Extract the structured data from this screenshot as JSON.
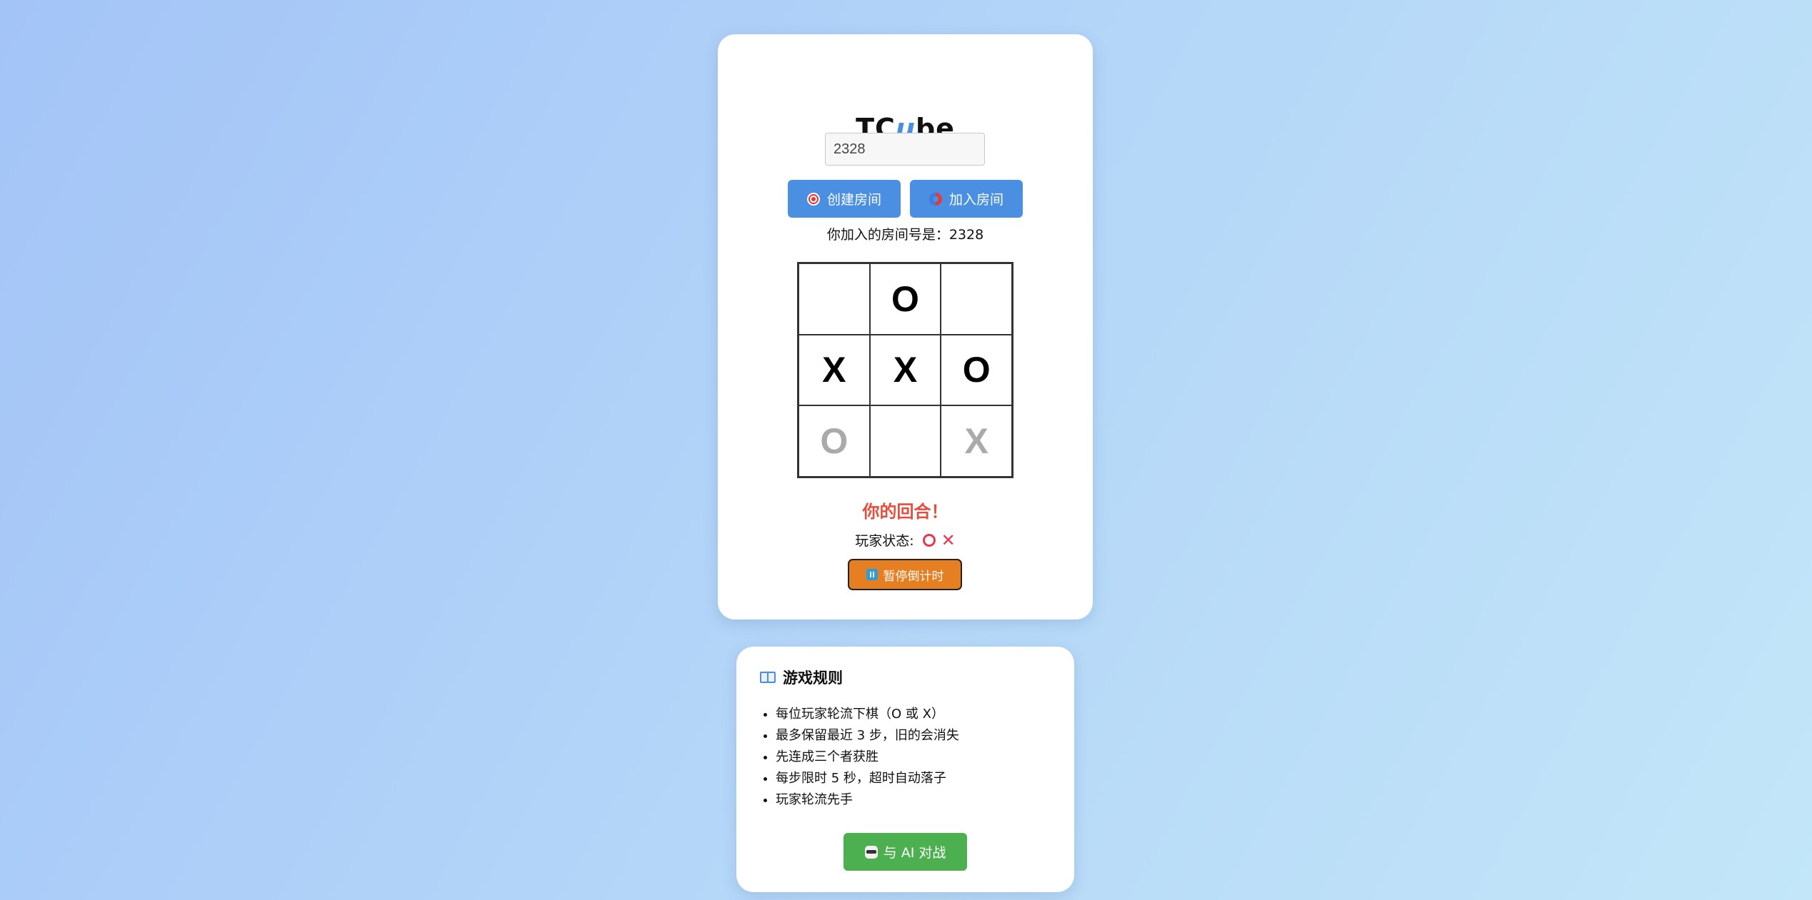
{
  "app": {
    "title_part1": "TC",
    "title_accent": "u",
    "title_part2": "be"
  },
  "room": {
    "input_value": "2328",
    "create_label": "创建房间",
    "create_icon": "target-icon",
    "join_label": "加入房间",
    "join_icon": "magnet-icon",
    "status_text": "你加入的房间号是：2328"
  },
  "board": {
    "cells": [
      "",
      "O",
      "",
      "X",
      "X",
      "O",
      "O",
      "",
      "X"
    ],
    "fading_cells": [
      6,
      8
    ]
  },
  "game": {
    "turn_text": "你的回合！",
    "players_label": "玩家状态:",
    "player_icons": [
      "ring-icon",
      "cross-icon"
    ],
    "cross_glyph": "✕",
    "pause_label": "暂停倒计时",
    "pause_icon": "pause-icon"
  },
  "rules": {
    "heading": "游戏规则",
    "heading_icon": "book-icon",
    "items": [
      "每位玩家轮流下棋（O 或 X）",
      "最多保留最近 3 步，旧的会消失",
      "先连成三个者获胜",
      "每步限时 5 秒，超时自动落子",
      "玩家轮流先手"
    ],
    "ai_label": "与 AI 对战",
    "ai_icon": "robot-icon"
  },
  "colors": {
    "primary": "#4a8fe2",
    "accent_title": "#4a8ee0",
    "turn": "#e74c3c",
    "pause": "#e67e22",
    "ai": "#4caf50",
    "player_mark": "#e8384f"
  }
}
